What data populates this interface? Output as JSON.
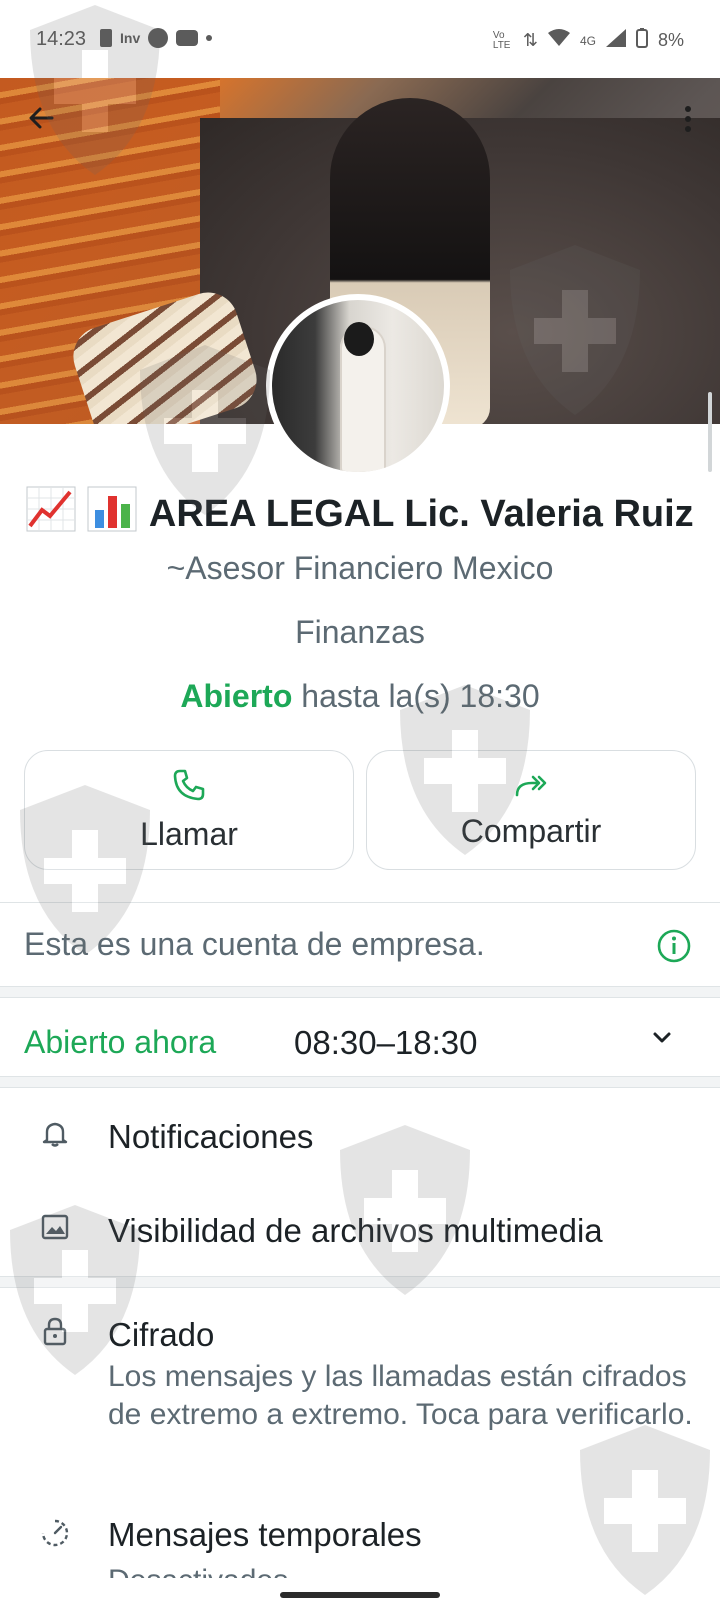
{
  "status_bar": {
    "time": "14:23",
    "app_badge": "Inv",
    "network": "4G",
    "volte": "Vo LTE",
    "battery": "8%"
  },
  "profile": {
    "name": "AREA LEGAL Lic. Valeria Ruiz",
    "name_emojis": "📈📊",
    "subtitle": "~Asesor Financiero Mexico",
    "category": "Finanzas",
    "status_open": "Abierto",
    "status_rest": "hasta la(s) 18:30"
  },
  "actions": {
    "call_label": "Llamar",
    "share_label": "Compartir"
  },
  "business_info": "Esta es una cuenta de empresa.",
  "hours": {
    "open_now": "Abierto ahora",
    "range": "08:30–18:30"
  },
  "settings": {
    "notifications": "Notificaciones",
    "media_visibility": "Visibilidad de archivos multimedia",
    "encryption_title": "Cifrado",
    "encryption_desc": "Los mensajes y las llamadas están cifrados de extremo a extremo. Toca para verificarlo.",
    "temp_messages_title": "Mensajes temporales",
    "temp_messages_desc": "Desactivados"
  },
  "colors": {
    "accent_green": "#1da857",
    "text_primary": "#1c2226",
    "text_secondary": "#5c6a73"
  }
}
